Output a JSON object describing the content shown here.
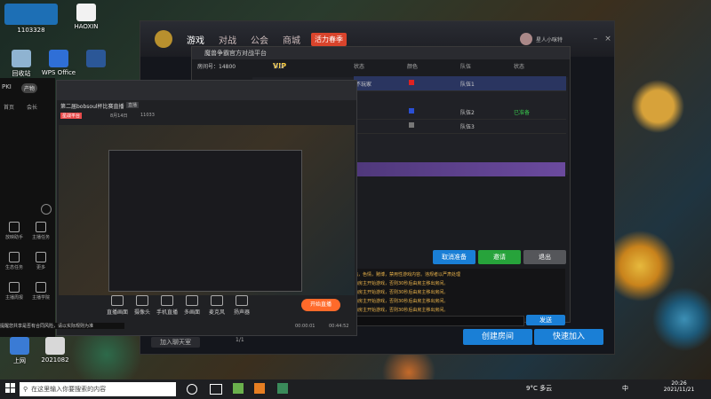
{
  "desktop": {
    "icons": [
      {
        "label": "回收站"
      },
      {
        "label": "WPS Office"
      },
      {
        "label": "上网"
      }
    ],
    "login_id": "1103328",
    "brand": "HAOXIN",
    "date_label": "2021082"
  },
  "game": {
    "tabs": [
      "游戏",
      "对战",
      "公会",
      "商城"
    ],
    "promo": "活力春季",
    "user_label": "星人小咪特",
    "dialog_title": "魔兽争霸官方对战平台",
    "room_no_label": "房间号：",
    "room_no": "14800",
    "vip": "VIP",
    "columns": [
      "队伍",
      "状态",
      "颜色",
      "队伍",
      "状态"
    ],
    "rows": [
      {
        "name": "不玩家",
        "team": "队伍1",
        "status": ""
      },
      {
        "name": "",
        "team": "队伍2",
        "status": "已准备"
      },
      {
        "name": "",
        "team": "队伍3",
        "status": ""
      },
      {
        "name": "",
        "team": "",
        "status": ""
      }
    ],
    "buttons": {
      "cancel": "取消准备",
      "invite": "邀请",
      "leave": "退出"
    },
    "chat_lines": [
      "出，色情，赌博，禁用性游戏内容。违规者以严肃处理",
      "由房主开始游戏，否则30秒后由房主移出房间。",
      "由房主开始游戏，否则30秒后由房主移出房间。",
      "由房主开始游戏，否则30秒后由房主移出房间。",
      "由房主开始游戏，否则30秒后由房主移出房间。"
    ],
    "send": "发送",
    "create_room": "创建房间",
    "quick_join": "快速加入",
    "add_friend": "加入聊天室",
    "page": "1/1"
  },
  "left_panel": {
    "tab": "产物",
    "rooms": [
      "首页",
      "会长"
    ],
    "icons": [
      "放映助手",
      "主播任务",
      "生态任务",
      "更多",
      "主播周报",
      "主播学院"
    ]
  },
  "obs": {
    "title": "第二届bobsoul杯比赛直播",
    "tag": "直播",
    "info": [
      "星战平台",
      "8月14日",
      "11033"
    ],
    "toolbar": [
      "直播画面",
      "摄像头",
      "手机直播",
      "多画面",
      "麦克风",
      "扬声器"
    ],
    "start": "开始直播",
    "time_a": "00:00:01",
    "time_b": "00:44:52",
    "notice": "提醒您共享是否有合同风险，请以实际规则为准"
  },
  "taskbar": {
    "search_placeholder": "在这里输入你要搜索的内容",
    "weather": "9°C 多云",
    "ime": "中",
    "time": "20:26",
    "date": "2021/11/21"
  },
  "colors": {
    "accent": "#1a7fd6",
    "green": "#27a33b"
  }
}
